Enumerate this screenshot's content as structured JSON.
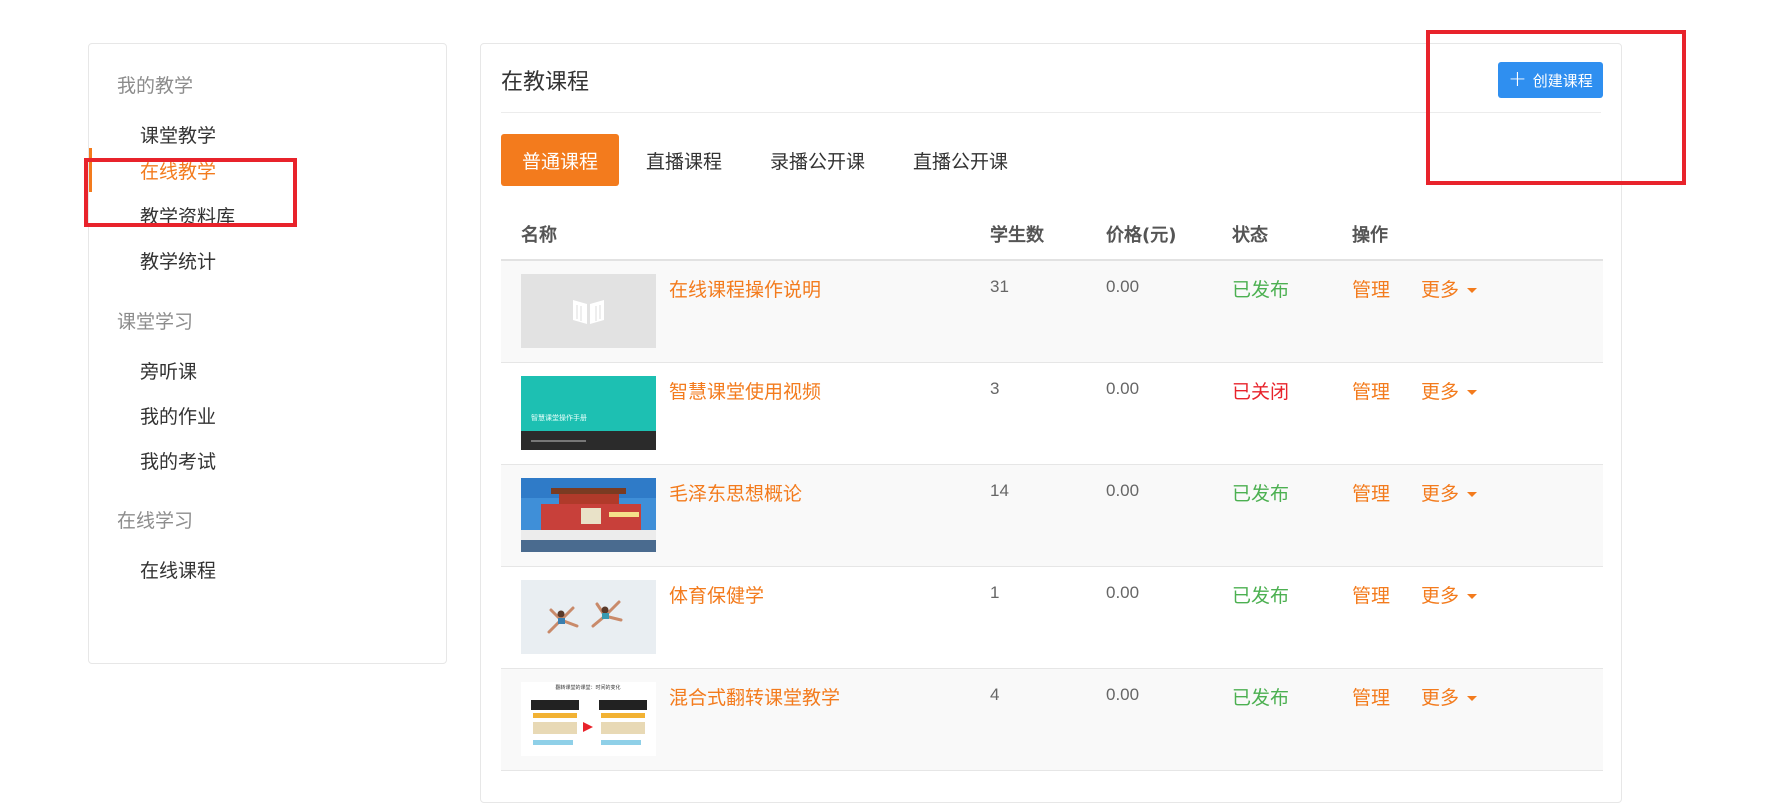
{
  "sidebar": {
    "groups": [
      {
        "title": "我的教学",
        "items": [
          "课堂教学",
          "在线教学",
          "教学资料库",
          "教学统计"
        ]
      },
      {
        "title": "课堂学习",
        "items": [
          "旁听课",
          "我的作业",
          "我的考试"
        ]
      },
      {
        "title": "在线学习",
        "items": [
          "在线课程"
        ]
      }
    ],
    "active_item": "在线教学"
  },
  "main": {
    "title": "在教课程",
    "create_button": {
      "label": "创建课程",
      "icon": "plus-icon",
      "color": "#2f8ff0"
    },
    "tabs": [
      {
        "label": "普通课程",
        "active": true
      },
      {
        "label": "直播课程",
        "active": false
      },
      {
        "label": "录播公开课",
        "active": false
      },
      {
        "label": "直播公开课",
        "active": false
      }
    ],
    "table": {
      "headers": {
        "name": "名称",
        "students": "学生数",
        "price": "价格(元)",
        "status": "状态",
        "actions": "操作"
      },
      "rows": [
        {
          "name": "在线课程操作说明",
          "students": "31",
          "price": "0.00",
          "status": "已发布",
          "status_color": "#4cb051",
          "manage": "管理",
          "more": "更多",
          "thumb": "book-placeholder"
        },
        {
          "name": "智慧课堂使用视频",
          "students": "3",
          "price": "0.00",
          "status": "已关闭",
          "status_color": "#e8232b",
          "manage": "管理",
          "more": "更多",
          "thumb": "teal-manual-cover"
        },
        {
          "name": "毛泽东思想概论",
          "students": "14",
          "price": "0.00",
          "status": "已发布",
          "status_color": "#4cb051",
          "manage": "管理",
          "more": "更多",
          "thumb": "tiananmen-photo"
        },
        {
          "name": "体育保健学",
          "students": "1",
          "price": "0.00",
          "status": "已发布",
          "status_color": "#4cb051",
          "manage": "管理",
          "more": "更多",
          "thumb": "runners-photo"
        },
        {
          "name": "混合式翻转课堂教学",
          "students": "4",
          "price": "0.00",
          "status": "已发布",
          "status_color": "#4cb051",
          "manage": "管理",
          "more": "更多",
          "thumb": "flipped-classroom-diagram"
        }
      ]
    }
  },
  "thumb_text": {
    "manual_title": "智慧课堂操作手册",
    "diagram_title": "翻转课堂的课堂：时间的变化"
  },
  "colors": {
    "accent": "#f37b1d",
    "primary": "#2f8ff0",
    "published": "#4cb051",
    "closed": "#e8232b",
    "highlight": "#e8232b"
  }
}
